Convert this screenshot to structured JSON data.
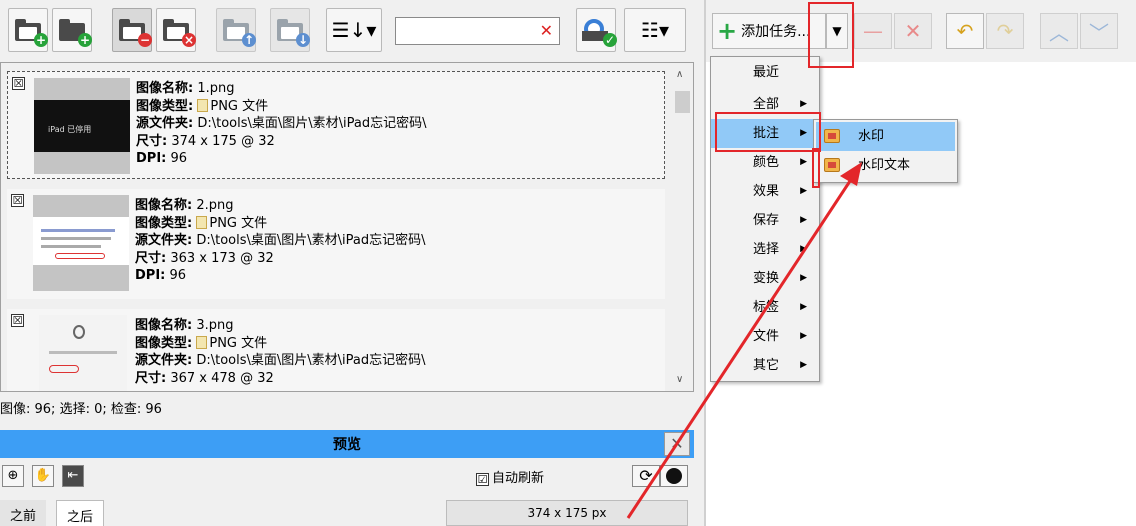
{
  "toolbar": {
    "sort_icon": "sort-down-icon",
    "search": {
      "value": "",
      "placeholder": ""
    },
    "search_clear": "✕"
  },
  "right_toolbar": {
    "add_task_label": "添加任务...",
    "add_icon": "plus-icon"
  },
  "images": [
    {
      "name_label": "图像名称",
      "name": "1.png",
      "type_label": "图像类型",
      "type": "PNG 文件",
      "folder_label": "源文件夹",
      "folder": "D:\\tools\\桌面\\图片\\素材\\iPad忘记密码\\",
      "size_label": "尺寸",
      "size": "374 x 175 @ 32",
      "dpi_label": "DPI",
      "dpi": "96",
      "thumb_text": "iPad 已停用",
      "checked": "☒"
    },
    {
      "name_label": "图像名称",
      "name": "2.png",
      "type_label": "图像类型",
      "type": "PNG 文件",
      "folder_label": "源文件夹",
      "folder": "D:\\tools\\桌面\\图片\\素材\\iPad忘记密码\\",
      "size_label": "尺寸",
      "size": "363 x 173 @ 32",
      "dpi_label": "DPI",
      "dpi": "96",
      "checked": "☒"
    },
    {
      "name_label": "图像名称",
      "name": "3.png",
      "type_label": "图像类型",
      "type": "PNG 文件",
      "folder_label": "源文件夹",
      "folder": "D:\\tools\\桌面\\图片\\素材\\iPad忘记密码\\",
      "size_label": "尺寸",
      "size": "367 x 478 @ 32",
      "checked": "☒"
    }
  ],
  "status_bar": "图像: 96; 选择: 0; 检查: 96",
  "preview": {
    "title": "预览",
    "close": "✕",
    "auto_refresh_label": "自动刷新",
    "auto_refresh_checked": "☑",
    "tab_before": "之前",
    "tab_after": "之后",
    "image_size": "374 x 175 px"
  },
  "menu": {
    "items": [
      "最近",
      "全部",
      "批注",
      "颜色",
      "效果",
      "保存",
      "选择",
      "变换",
      "标签",
      "文件",
      "其它"
    ],
    "highlighted": "批注",
    "submenu": [
      "水印",
      "水印文本"
    ]
  },
  "colors": {
    "accent_blue": "#3d9ef5",
    "highlight": "#91c9f7",
    "annotation_red": "#e3262a"
  }
}
